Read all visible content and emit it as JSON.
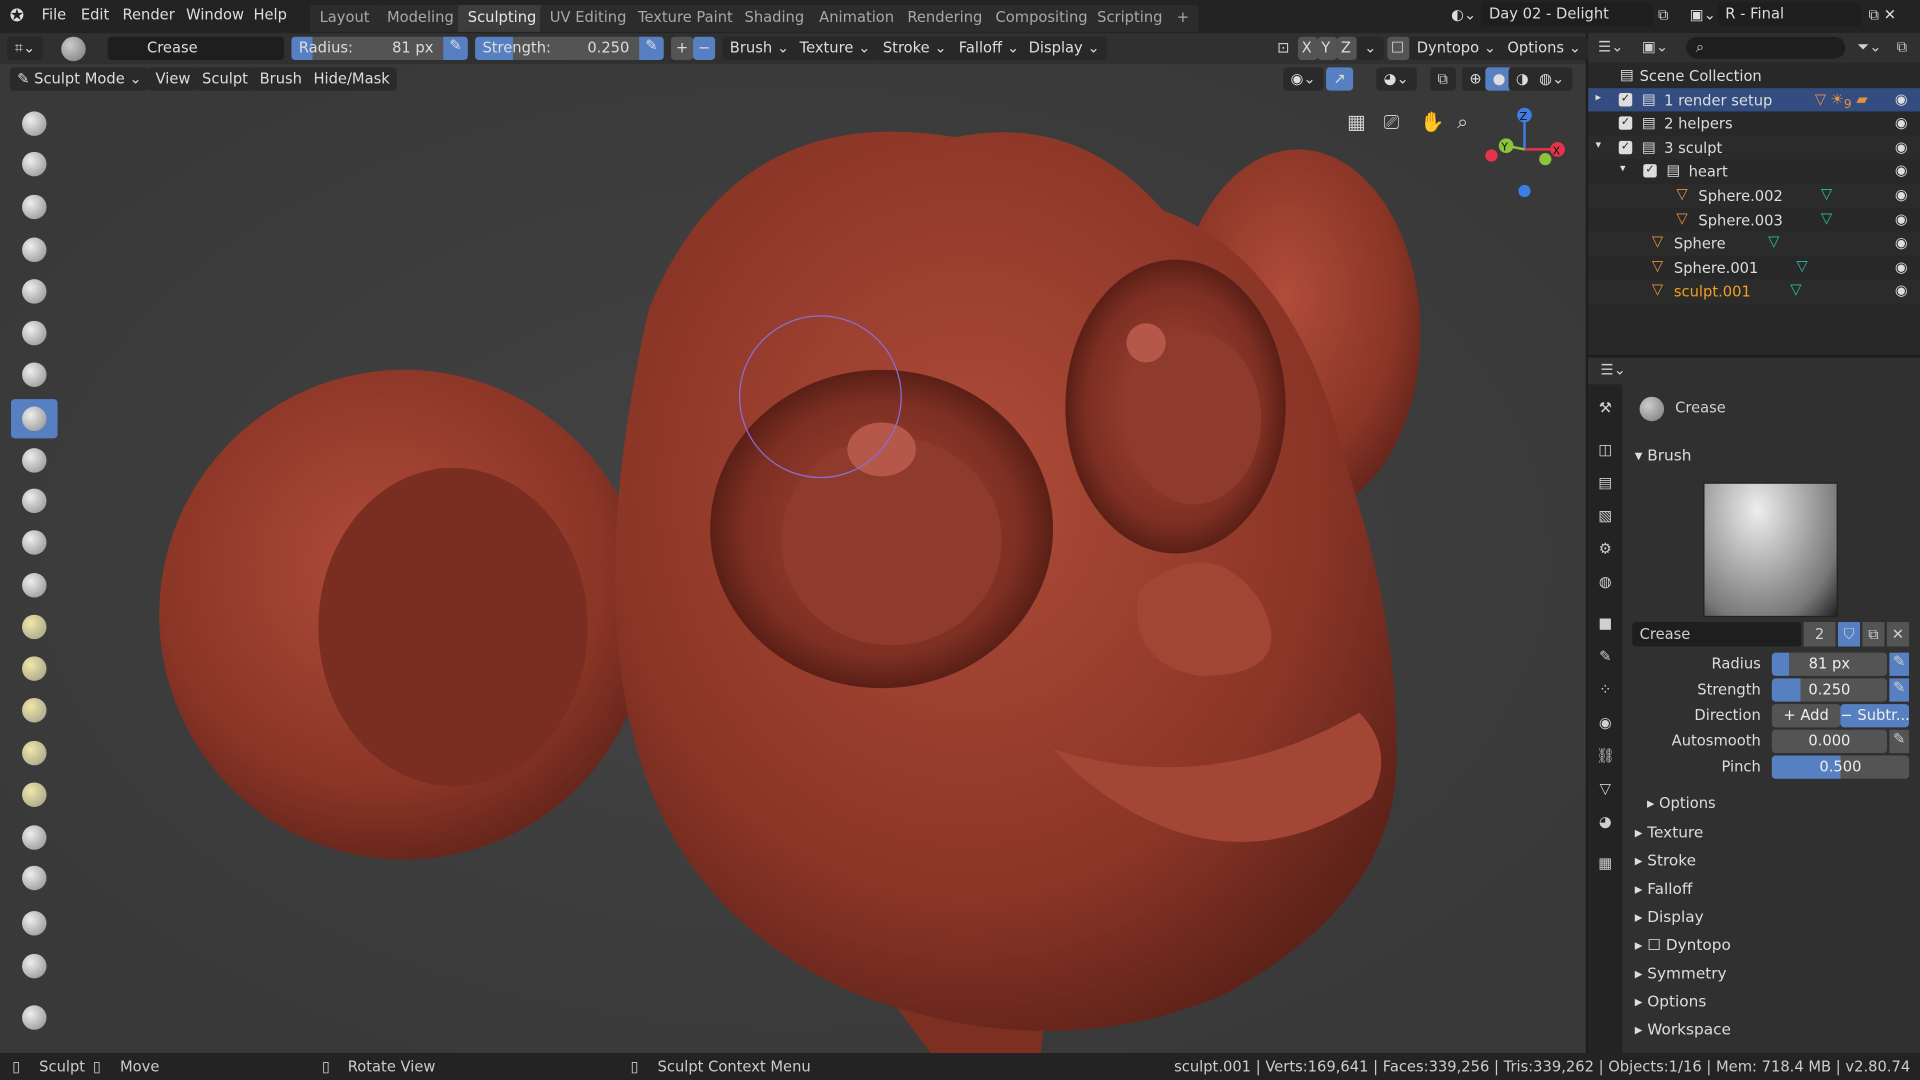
{
  "topbar": {
    "menus": [
      "File",
      "Edit",
      "Render",
      "Window",
      "Help"
    ],
    "workspaces": [
      "Layout",
      "Modeling",
      "Sculpting",
      "UV Editing",
      "Texture Paint",
      "Shading",
      "Animation",
      "Rendering",
      "Compositing",
      "Scripting"
    ],
    "active_workspace": "Sculpting",
    "add_tab": "+",
    "scene": "Day 02 - Delight",
    "view_layer": "R - Final"
  },
  "toolheader": {
    "brush_name": "Crease",
    "radius_label": "Radius:",
    "radius_value": "81 px",
    "strength_label": "Strength:",
    "strength_value": "0.250",
    "plus": "+",
    "minus": "−",
    "dropdowns": [
      "Brush",
      "Texture",
      "Stroke",
      "Falloff",
      "Display"
    ],
    "axes": [
      "X",
      "Y",
      "Z"
    ],
    "dyntopo": "Dyntopo",
    "options": "Options"
  },
  "viewport_header": {
    "mode": "Sculpt Mode",
    "menus": [
      "View",
      "Sculpt",
      "Brush",
      "Hide/Mask"
    ]
  },
  "gizmo": {
    "x": "X",
    "y": "Y",
    "z": "Z",
    "colors": {
      "x": "#e5344a",
      "y": "#8bc43a",
      "z": "#3d7ee2"
    }
  },
  "outliner": {
    "root": "Scene Collection",
    "rows": [
      {
        "name": "1 render setup",
        "selected": true
      },
      {
        "name": "2 helpers"
      },
      {
        "name": "3 sculpt"
      },
      {
        "name": "heart"
      },
      {
        "name": "Sphere.002"
      },
      {
        "name": "Sphere.003"
      },
      {
        "name": "Sphere"
      },
      {
        "name": "Sphere.001"
      },
      {
        "name": "sculpt.001",
        "active": true
      }
    ],
    "light_count": "9"
  },
  "properties": {
    "tool_name": "Crease",
    "brush_panel": "Brush",
    "brush_field": "Crease",
    "users": "2",
    "radius_label": "Radius",
    "radius": "81 px",
    "radius_fill": 0.15,
    "strength_label": "Strength",
    "strength": "0.250",
    "strength_fill": 0.25,
    "direction_label": "Direction",
    "add": "Add",
    "subtract": "Subtr...",
    "autosmooth_label": "Autosmooth",
    "autosmooth": "0.000",
    "pinch_label": "Pinch",
    "pinch": "0.500",
    "pinch_fill": 0.5,
    "options_sub": "Options",
    "panels": [
      "Texture",
      "Stroke",
      "Falloff",
      "Display",
      "Dyntopo",
      "Symmetry",
      "Options",
      "Workspace"
    ]
  },
  "status": {
    "left_click": "Sculpt",
    "middle": "Move",
    "rotate": "Rotate View",
    "context": "Sculpt Context Menu",
    "stats": "sculpt.001 | Verts:169,641 | Faces:339,256 | Tris:339,262 | Objects:1/16 | Mem: 718.4 MB | v2.80.74"
  },
  "accent": "#5680c2",
  "mesh_color": "#9c3c2c"
}
